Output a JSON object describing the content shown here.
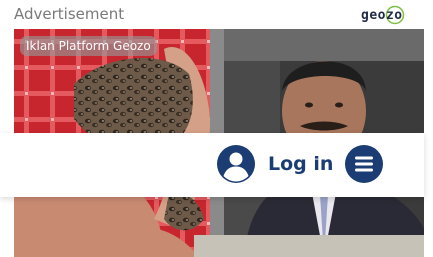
{
  "header": {
    "advertisement_label": "Advertisement",
    "logo_text": "geozo"
  },
  "ad": {
    "tag": "Iklan Platform Geozo"
  },
  "nav": {
    "login_label": "Log in",
    "user_icon": "user-circle-icon",
    "menu_icon": "hamburger-menu-icon"
  },
  "colors": {
    "brand_navy": "#1b3d73",
    "logo_green": "#7cc142"
  }
}
